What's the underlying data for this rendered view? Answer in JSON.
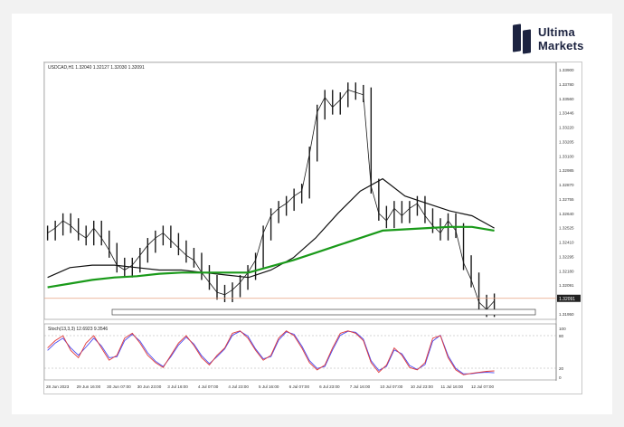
{
  "brand": {
    "line1": "Ultima",
    "line2": "Markets"
  },
  "chart_header": {
    "symbol_text": "USDCAD,H1  1.32040  1.32127  1.32030  1.32091",
    "osc_text": "Stoch(13,3,3) 12.6923 9.3546"
  },
  "price_axis": {
    "labels": [
      "1.33900",
      "1.33780",
      "1.33560",
      "1.33446",
      "1.33220",
      "1.33205",
      "1.33100",
      "1.32985",
      "1.32870",
      "1.32755",
      "1.32640",
      "1.32525",
      "1.32410",
      "1.32295",
      "1.32180",
      "1.32091",
      "1.32065",
      "1.31950"
    ],
    "current_price": "1.32091"
  },
  "osc_axis": {
    "labels": [
      "100",
      "80",
      "20",
      "0"
    ]
  },
  "time_axis": {
    "labels": [
      "28 Jun 2023",
      "29 Jun 16:00",
      "30 Jun 07:00",
      "30 Jun 23:00",
      "3 Jul 16:00",
      "4 Jul 07:00",
      "4 Jul 23:00",
      "5 Jul 16:00",
      "6 Jul 07:00",
      "6 Jul 23:00",
      "7 Jul 16:00",
      "10 Jul 07:00",
      "10 Jul 23:00",
      "11 Jul 16:00",
      "12 Jul 07:00"
    ]
  },
  "colors": {
    "candles": "#1a1a1a",
    "ma_fast": "#111111",
    "ma_slow": "#1a9a1a",
    "stoch_main": "#e03a3a",
    "stoch_signal": "#4a4af0",
    "price_line": "#e8a080"
  },
  "chart_data": {
    "type": "line",
    "symbol": "USDCAD",
    "timeframe": "H1",
    "price_ylim": [
      1.3195,
      1.339
    ],
    "x_labels": [
      "28 Jun 2023",
      "29 Jun 16:00",
      "30 Jun 07:00",
      "30 Jun 23:00",
      "3 Jul 16:00",
      "4 Jul 07:00",
      "4 Jul 23:00",
      "5 Jul 16:00",
      "6 Jul 07:00",
      "6 Jul 23:00",
      "7 Jul 16:00",
      "10 Jul 07:00",
      "10 Jul 23:00",
      "11 Jul 16:00",
      "12 Jul 07:00"
    ],
    "series": [
      {
        "values": [
          1.3262,
          1.3266,
          1.3272,
          1.3268,
          1.3262,
          1.3258,
          1.3266,
          1.3258,
          1.3248,
          1.3236,
          1.3232,
          1.3236,
          1.3244,
          1.3252,
          1.3258,
          1.3262,
          1.3256,
          1.325,
          1.3244,
          1.324,
          1.323,
          1.3222,
          1.3214,
          1.3212,
          1.3216,
          1.3222,
          1.323,
          1.324,
          1.3262,
          1.3276,
          1.3282,
          1.3286,
          1.3292,
          1.3296,
          1.3326,
          1.336,
          1.3372,
          1.3364,
          1.337,
          1.3378,
          1.3376,
          1.3374,
          1.33,
          1.3278,
          1.3272,
          1.3282,
          1.3276,
          1.3282,
          1.3286,
          1.3276,
          1.3268,
          1.3262,
          1.3272,
          1.3264,
          1.3238,
          1.3224,
          1.3206,
          1.32,
          1.3207
        ]
      },
      {
        "values": [
          1.3226,
          1.3234,
          1.3236,
          1.3236,
          1.3234,
          1.3232,
          1.3232,
          1.323,
          1.3228,
          1.3226,
          1.3232,
          1.3242,
          1.3258,
          1.3278,
          1.3296,
          1.3306,
          1.3292,
          1.3286,
          1.328,
          1.3276,
          1.3266
        ]
      },
      {
        "values": [
          1.3218,
          1.3221,
          1.3224,
          1.3226,
          1.3227,
          1.3229,
          1.323,
          1.323,
          1.323,
          1.323,
          1.3235,
          1.324,
          1.3246,
          1.3252,
          1.3258,
          1.3264,
          1.3265,
          1.3266,
          1.3267,
          1.3267,
          1.3264
        ]
      }
    ],
    "oscillator": {
      "name": "Stoch(13,3,3)",
      "ylim": [
        0,
        100
      ],
      "main": [
        60,
        75,
        85,
        55,
        40,
        70,
        85,
        60,
        35,
        45,
        80,
        90,
        70,
        45,
        30,
        20,
        45,
        70,
        85,
        65,
        40,
        25,
        45,
        60,
        90,
        95,
        80,
        55,
        35,
        45,
        80,
        95,
        85,
        60,
        30,
        15,
        25,
        60,
        90,
        95,
        90,
        75,
        30,
        10,
        25,
        60,
        45,
        20,
        15,
        30,
        80,
        85,
        40,
        15,
        5,
        8,
        10,
        12,
        13
      ],
      "signal": [
        55,
        70,
        80,
        60,
        45,
        62,
        80,
        64,
        40,
        42,
        75,
        88,
        74,
        50,
        33,
        22,
        42,
        66,
        82,
        68,
        44,
        28,
        42,
        58,
        86,
        94,
        84,
        58,
        38,
        42,
        76,
        93,
        88,
        64,
        34,
        18,
        22,
        56,
        86,
        94,
        92,
        78,
        34,
        14,
        22,
        56,
        48,
        24,
        16,
        26,
        74,
        86,
        44,
        18,
        7,
        7,
        9,
        10,
        9
      ]
    }
  }
}
